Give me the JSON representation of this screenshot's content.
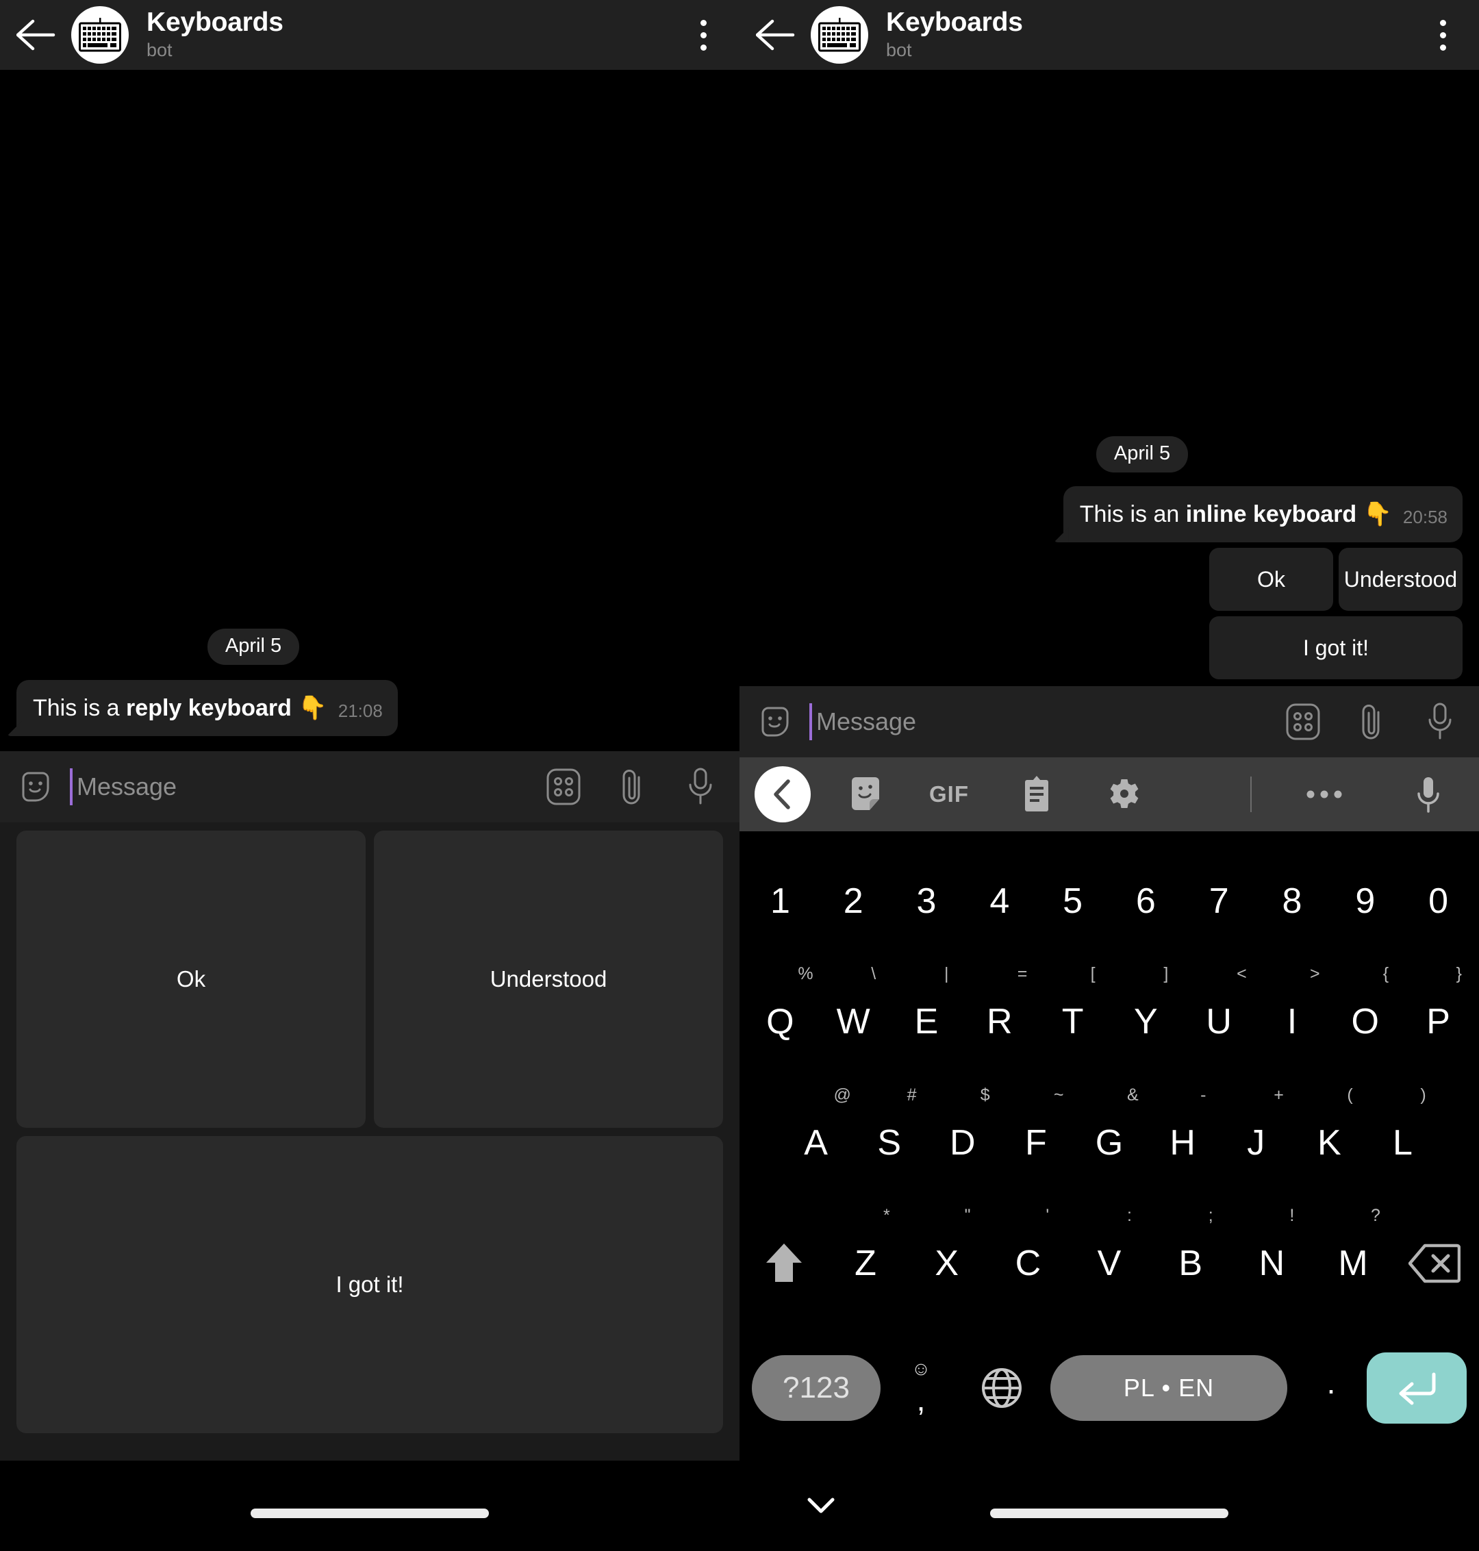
{
  "header": {
    "title": "Keyboards",
    "subtitle": "bot",
    "back_icon": "back-arrow-icon",
    "avatar_icon": "keyboard-avatar-icon",
    "menu_icon": "kebab-menu-icon"
  },
  "left_panel": {
    "date_chip": "April 5",
    "message": {
      "text_plain": "This is a ",
      "text_bold": "reply keyboard",
      "emoji": "👇",
      "time": "21:08"
    },
    "reply_keyboard": {
      "rows": [
        [
          "Ok",
          "Understood"
        ],
        [
          "I got it!"
        ]
      ]
    }
  },
  "right_panel": {
    "date_chip": "April 5",
    "message": {
      "text_plain": "This is an ",
      "text_bold": "inline keyboard",
      "emoji": "👇",
      "time": "20:58"
    },
    "inline_keyboard": {
      "rows": [
        [
          "Ok",
          "Understood"
        ],
        [
          "I got it!"
        ]
      ]
    }
  },
  "input_bar": {
    "placeholder": "Message",
    "value": "",
    "smiley_icon": "sticker-smiley-icon",
    "keyboard_toggle_icon": "bot-command-grid-icon",
    "attach_icon": "paperclip-icon",
    "mic_icon": "microphone-icon",
    "caret_color": "#9b6dd7"
  },
  "soft_keyboard": {
    "toolbar": {
      "back_icon": "chevron-left-icon",
      "sticker_icon": "sticker-icon",
      "gif_label": "GIF",
      "clipboard_icon": "clipboard-icon",
      "settings_icon": "gear-icon",
      "more_icon": "more-dots-icon",
      "mic_icon": "microphone-icon"
    },
    "rows": [
      {
        "name": "number-row",
        "keys": [
          {
            "main": "1"
          },
          {
            "main": "2"
          },
          {
            "main": "3"
          },
          {
            "main": "4"
          },
          {
            "main": "5"
          },
          {
            "main": "6"
          },
          {
            "main": "7"
          },
          {
            "main": "8"
          },
          {
            "main": "9"
          },
          {
            "main": "0"
          }
        ]
      },
      {
        "name": "qwerty-row",
        "keys": [
          {
            "main": "Q",
            "sub": "%"
          },
          {
            "main": "W",
            "sub": "\\"
          },
          {
            "main": "E",
            "sub": "|"
          },
          {
            "main": "R",
            "sub": "="
          },
          {
            "main": "T",
            "sub": "["
          },
          {
            "main": "Y",
            "sub": "]"
          },
          {
            "main": "U",
            "sub": "<"
          },
          {
            "main": "I",
            "sub": ">"
          },
          {
            "main": "O",
            "sub": "{"
          },
          {
            "main": "P",
            "sub": "}"
          }
        ]
      },
      {
        "name": "asdf-row",
        "keys": [
          {
            "main": "A",
            "sub": "@"
          },
          {
            "main": "S",
            "sub": "#"
          },
          {
            "main": "D",
            "sub": "$"
          },
          {
            "main": "F",
            "sub": "~"
          },
          {
            "main": "G",
            "sub": "&"
          },
          {
            "main": "H",
            "sub": "-"
          },
          {
            "main": "J",
            "sub": "+"
          },
          {
            "main": "K",
            "sub": "("
          },
          {
            "main": "L",
            "sub": ")"
          }
        ]
      },
      {
        "name": "zxcv-row",
        "keys": [
          {
            "main": "",
            "icon": "shift-icon"
          },
          {
            "main": "Z",
            "sub": "*"
          },
          {
            "main": "X",
            "sub": "\""
          },
          {
            "main": "C",
            "sub": "'"
          },
          {
            "main": "V",
            "sub": ":"
          },
          {
            "main": "B",
            "sub": ";"
          },
          {
            "main": "N",
            "sub": "!"
          },
          {
            "main": "M",
            "sub": "?"
          },
          {
            "main": "",
            "icon": "backspace-icon"
          }
        ]
      }
    ],
    "bottom_row": {
      "symbols_label": "?123",
      "comma_label": ",",
      "comma_emoji": "☺",
      "globe_icon": "globe-icon",
      "space_label": "PL • EN",
      "period_label": ".",
      "enter_icon": "enter-icon",
      "enter_color": "#8ed3cd"
    },
    "hide_keyboard_icon": "chevron-down-icon"
  },
  "nav": {
    "home_indicator": "home-indicator-pill"
  }
}
